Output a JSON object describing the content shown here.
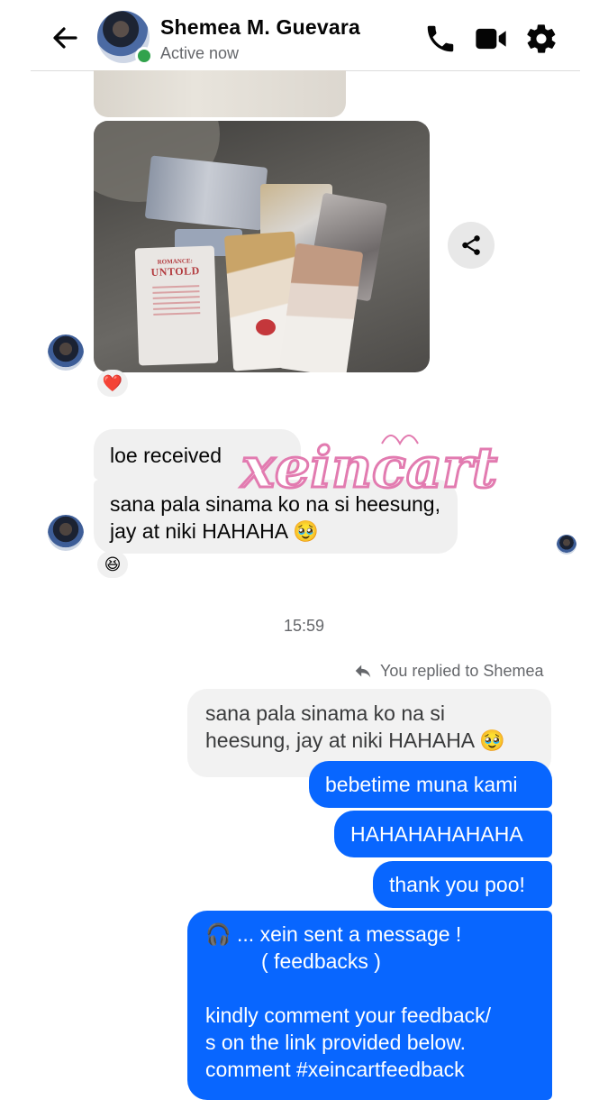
{
  "header": {
    "contact_name": "Shemea M. Guevara",
    "status": "Active now",
    "icons": [
      "back-arrow-icon",
      "phone-icon",
      "video-camera-icon",
      "gear-icon"
    ],
    "online_color": "#31a24c"
  },
  "media": {
    "album_title_line1": "ROMANCE:",
    "album_title_line2": "UNTOLD"
  },
  "messages": {
    "reaction_heart": "❤️",
    "incoming_1": "loe received",
    "incoming_2": "sana pala sinama ko na si heesung, jay at niki HAHAHA 🥹",
    "reaction_laugh": "😆",
    "timestamp": "15:59",
    "replied_label": "You replied to Shemea",
    "quoted": "sana pala sinama ko na si heesung, jay at niki HAHAHA 🥹",
    "out_1": "bebetime muna kami",
    "out_2": "HAHAHAHAHAHA",
    "out_3": "thank you poo!",
    "out_4_line1": "🎧 ... xein sent a message !",
    "out_4_line2": "( feedbacks )",
    "out_4_line3": "kindly comment your feedback/",
    "out_4_line4": "s on the link provided below.",
    "out_4_line5": "comment #xeincartfeedback"
  },
  "watermark": {
    "text": "xeincart"
  },
  "colors": {
    "outgoing_bubble": "#0866ff",
    "incoming_bubble": "#f0f0f0",
    "watermark": "#e27bb0"
  }
}
